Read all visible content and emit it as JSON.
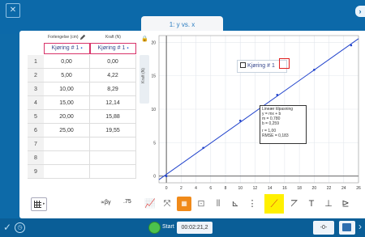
{
  "window": {
    "tab_title": "1: y vs. x"
  },
  "table": {
    "columns": [
      {
        "header": "Forlengelse (cm)",
        "run_label": "Kjøring # 1"
      },
      {
        "header": "Kraft (N)",
        "run_label": "Kjøring # 1"
      }
    ],
    "rows": [
      {
        "num": "1",
        "x": "0,00",
        "y": "0,00"
      },
      {
        "num": "2",
        "x": "5,00",
        "y": "4,22"
      },
      {
        "num": "3",
        "x": "10,00",
        "y": "8,29"
      },
      {
        "num": "4",
        "x": "15,00",
        "y": "12,14"
      },
      {
        "num": "5",
        "x": "20,00",
        "y": "15,88"
      },
      {
        "num": "6",
        "x": "25,00",
        "y": "19,55"
      },
      {
        "num": "7",
        "x": "",
        "y": ""
      },
      {
        "num": "8",
        "x": "",
        "y": ""
      },
      {
        "num": "9",
        "x": "",
        "y": ""
      }
    ]
  },
  "graph": {
    "y_axis_label": "Kraft (N)",
    "legend_label": "Kjøring # 1",
    "fit_box": {
      "line1": "Lineær tilpasning",
      "line2": "y = mx + b",
      "line3": "m = 0,780",
      "line4": "b = 0,259",
      "line5": "r = 1,00",
      "line6": "RMSE = 0,183"
    }
  },
  "chart_data": {
    "type": "scatter",
    "x": [
      0,
      5,
      10,
      15,
      20,
      25
    ],
    "series": [
      {
        "name": "Kjøring # 1",
        "values": [
          0,
          4.22,
          8.29,
          12.14,
          15.88,
          19.55
        ]
      }
    ],
    "fit": {
      "m": 0.78,
      "b": 0.259
    },
    "xlim": [
      -1,
      26
    ],
    "ylim": [
      -1,
      21
    ],
    "x_ticks": [
      0,
      2,
      4,
      6,
      8,
      10,
      12,
      14,
      16,
      18,
      20,
      22,
      24,
      26
    ],
    "y_ticks": [
      0,
      5,
      10,
      15,
      20
    ],
    "ylabel": "Kraft (N)",
    "xlabel": "",
    "grid": true,
    "title": "",
    "line_color": "#2244cc"
  },
  "toolbar": {
    "beta_label": "∝βγ",
    "decimals_label": ".75"
  },
  "footer": {
    "start_label": "Start",
    "timer": "00:02:21,2",
    "zero_label": "-0-"
  }
}
